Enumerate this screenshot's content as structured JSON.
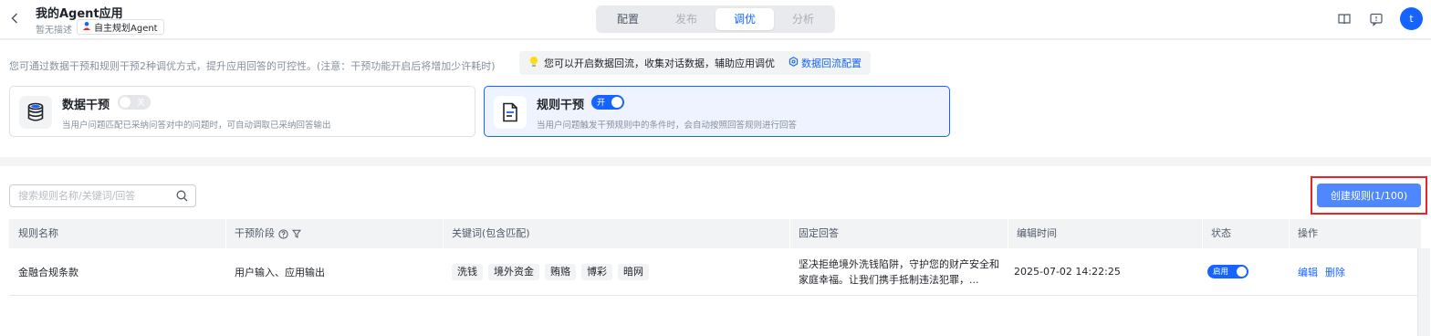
{
  "header": {
    "title": "我的Agent应用",
    "description": "暂无描述",
    "agent_tag": "自主规划Agent",
    "tabs": [
      {
        "label": "配置",
        "state": "normal"
      },
      {
        "label": "发布",
        "state": "disabled"
      },
      {
        "label": "调优",
        "state": "active"
      },
      {
        "label": "分析",
        "state": "disabled"
      }
    ],
    "avatar_letter": "t",
    "icons": [
      "back-chevron-icon",
      "book-icon",
      "feedback-icon"
    ]
  },
  "intro": {
    "text": "您可通过数据干预和规则干预2种调优方式，提升应用回答的可控性。(注意：干预功能开启后将增加少许耗时)",
    "tip": {
      "icon": "bulb-icon",
      "text": "您可以开启数据回流，收集对话数据，辅助应用调优",
      "config_link": "数据回流配置"
    },
    "cards": [
      {
        "title": "数据干预",
        "switch_label": "关",
        "enabled": false,
        "description": "当用户问题匹配已采纳问答对中的问题时，可自动调取已采纳回答输出",
        "icon": "database-icon"
      },
      {
        "title": "规则干预",
        "switch_label": "开",
        "enabled": true,
        "description": "当用户问题触发干预规则中的条件时，会自动按照回答规则进行回答",
        "icon": "rule-document-icon"
      }
    ]
  },
  "rules": {
    "search_placeholder": "搜索规则名称/关键词/回答",
    "create_button": "创建规则(1/100)",
    "columns": [
      "规则名称",
      "干预阶段",
      "关键词(包含匹配)",
      "固定回答",
      "编辑时间",
      "状态",
      "操作"
    ],
    "rows": [
      {
        "name": "金融合规条款",
        "stage": "用户输入、应用输出",
        "keywords": [
          "洗钱",
          "境外资金",
          "贿赂",
          "博彩",
          "暗网"
        ],
        "answer": "坚决拒绝境外洗钱陷阱，守护您的财产安全和家庭幸福。让我们携手抵制违法犯罪，...",
        "edit_time": "2025-07-02 14:22:25",
        "status_label": "启用",
        "status_enabled": true,
        "actions": [
          "编辑",
          "删除"
        ]
      }
    ]
  },
  "colors": {
    "primary": "#1664ff",
    "highlight_border": "#e8232a"
  }
}
